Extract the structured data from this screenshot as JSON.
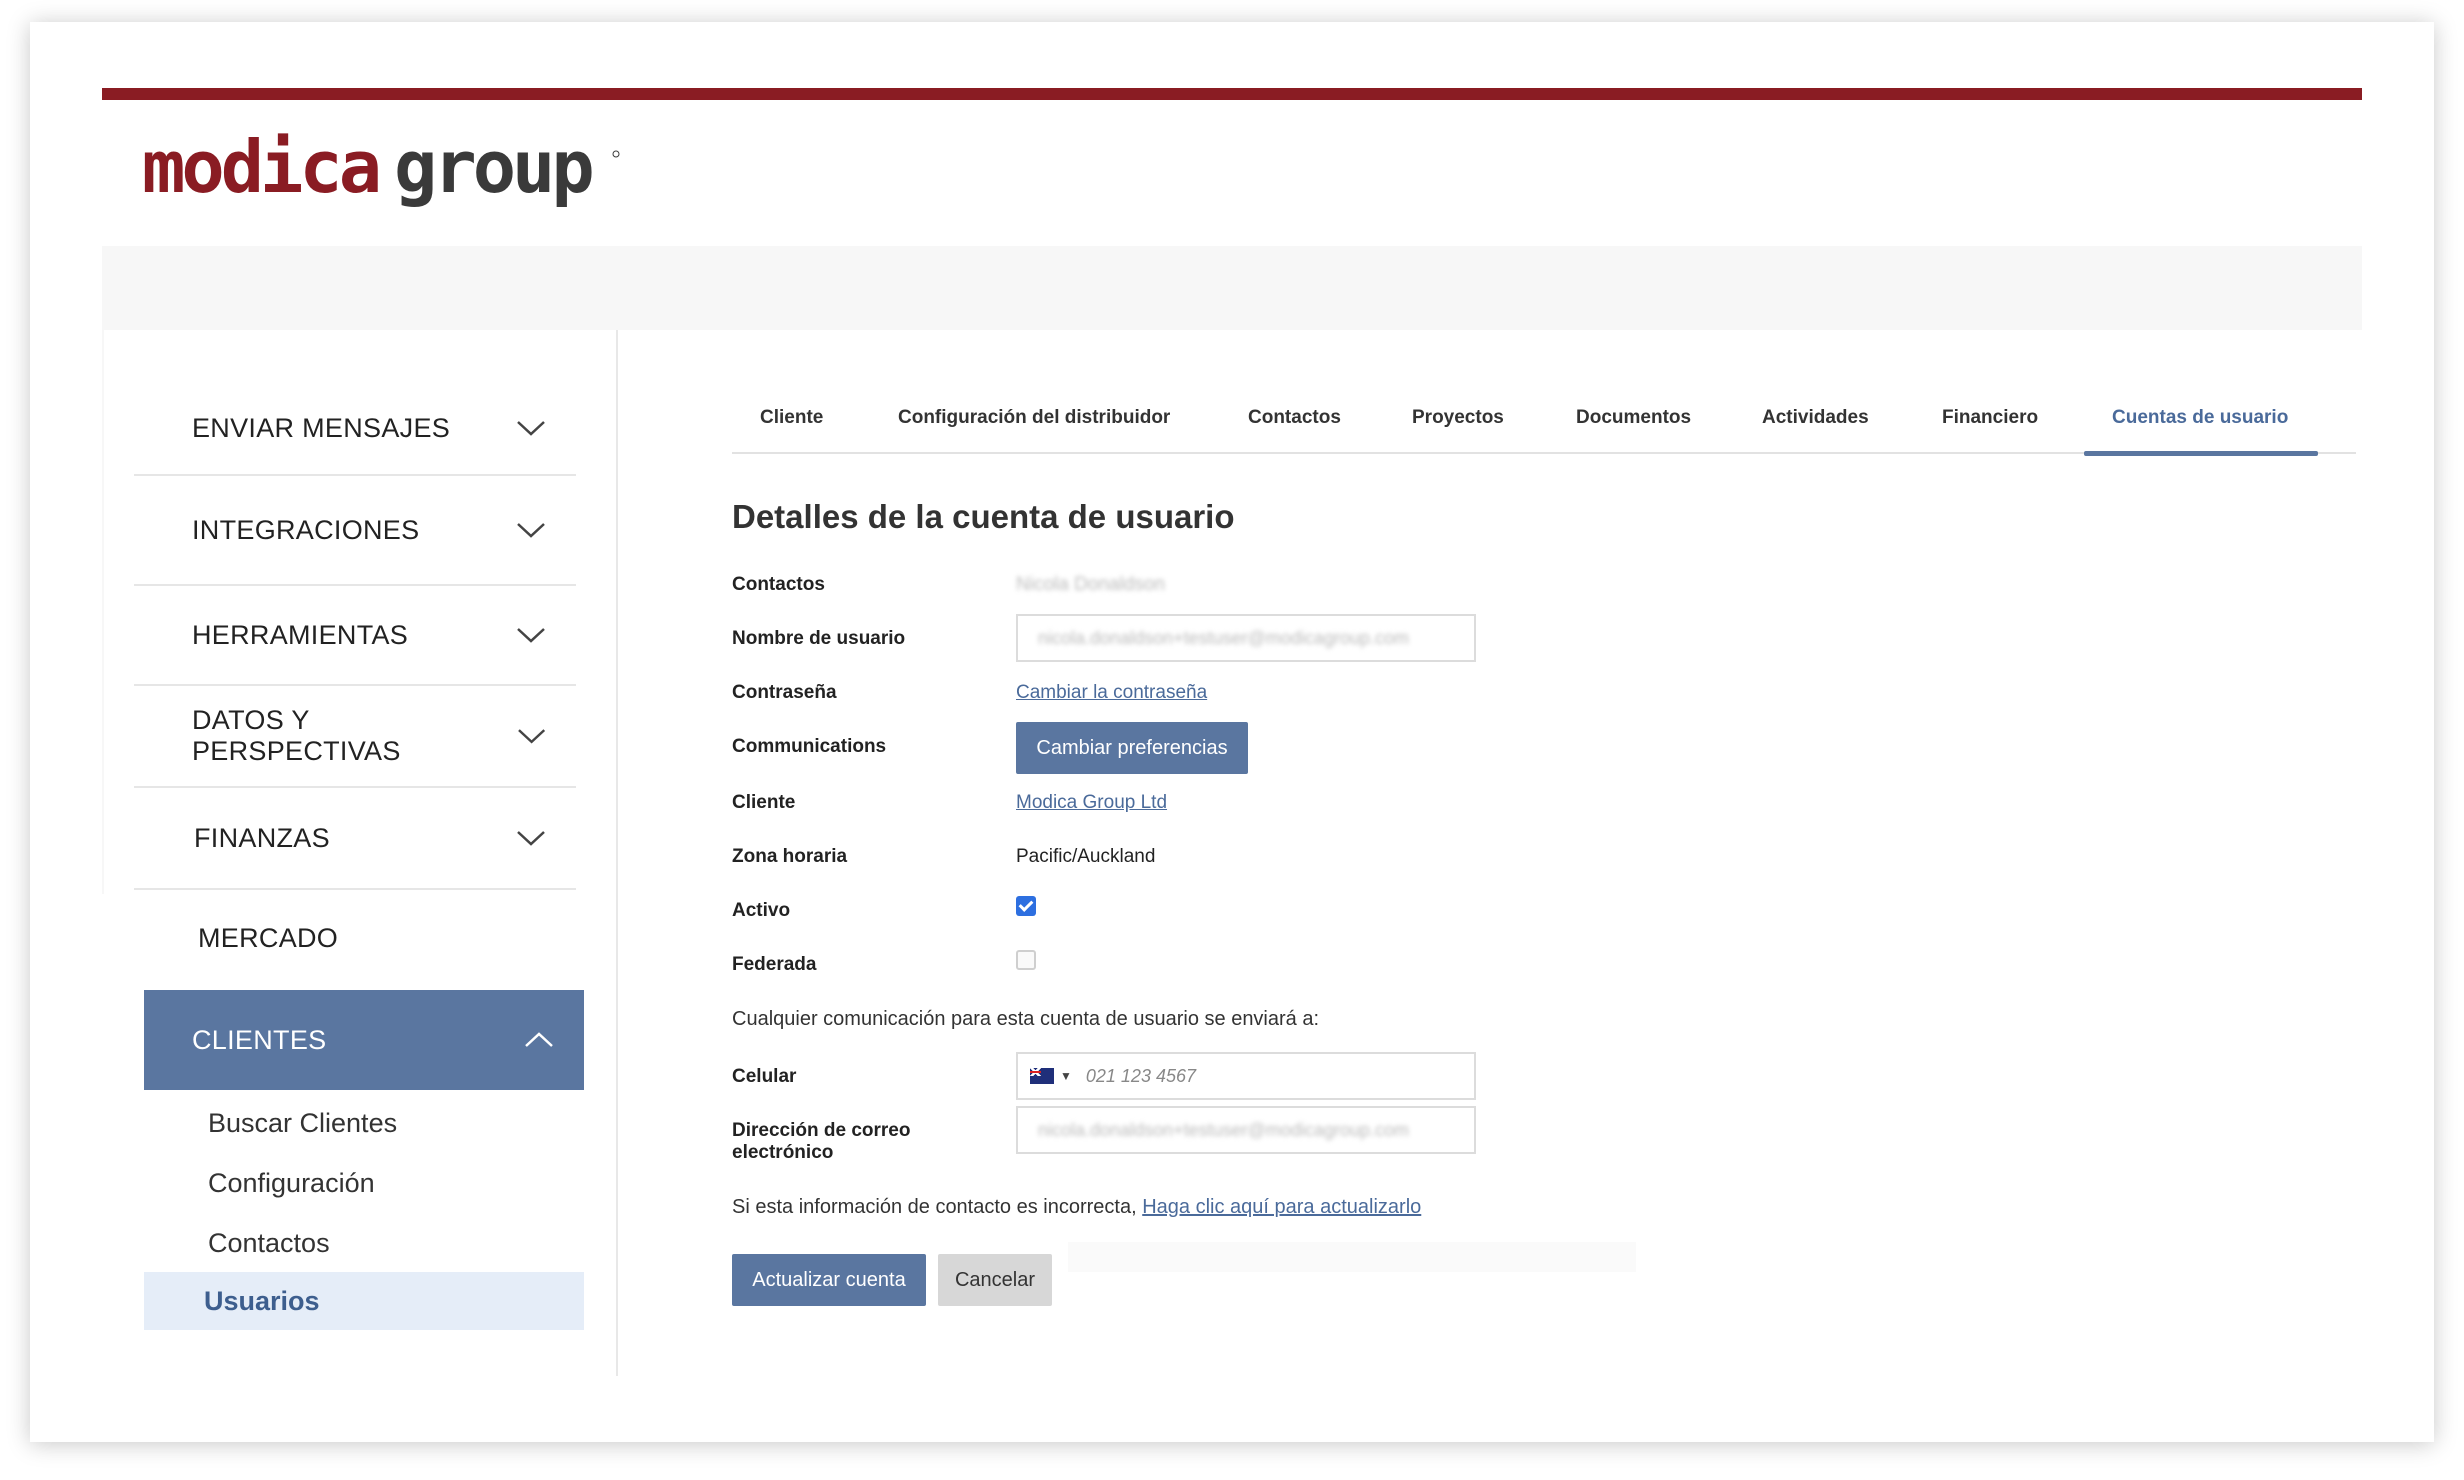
{
  "brand": {
    "logo_part1": "modica",
    "logo_part2": "group",
    "primary_color": "#8a1c23",
    "accent_color": "#5a76a0"
  },
  "sidebar": {
    "items": [
      {
        "label": "ENVIAR MENSAJES",
        "icon": "chevron-down-icon"
      },
      {
        "label": "INTEGRACIONES",
        "icon": "chevron-down-icon"
      },
      {
        "label": "HERRAMIENTAS",
        "icon": "chevron-down-icon"
      },
      {
        "label": "DATOS Y PERSPECTIVAS",
        "icon": "chevron-down-icon"
      },
      {
        "label": "FINANZAS",
        "icon": "chevron-down-icon"
      },
      {
        "label": "MERCADO"
      },
      {
        "label": "CLIENTES",
        "icon": "chevron-up-icon",
        "active": true
      }
    ],
    "subitems": [
      {
        "label": "Buscar Clientes"
      },
      {
        "label": "Configuración"
      },
      {
        "label": "Contactos"
      },
      {
        "label": "Usuarios",
        "active": true
      }
    ]
  },
  "tabs": [
    {
      "label": "Cliente"
    },
    {
      "label": "Configuración del distribuidor"
    },
    {
      "label": "Contactos"
    },
    {
      "label": "Proyectos"
    },
    {
      "label": "Documentos"
    },
    {
      "label": "Actividades"
    },
    {
      "label": "Financiero"
    },
    {
      "label": "Cuentas de usuario",
      "active": true
    }
  ],
  "form": {
    "title": "Detalles de la cuenta de usuario",
    "contactos_label": "Contactos",
    "contactos_value": "Nicola Donaldson",
    "username_label": "Nombre de usuario",
    "username_value": "nicola.donaldson+testuser@modicagroup.com",
    "password_label": "Contraseña",
    "password_link": "Cambiar la contraseña",
    "communications_label": "Communications",
    "communications_button": "Cambiar preferencias",
    "client_label": "Cliente",
    "client_link": "Modica Group Ltd",
    "timezone_label": "Zona horaria",
    "timezone_value": "Pacific/Auckland",
    "active_label": "Activo",
    "active_checked": true,
    "federated_label": "Federada",
    "federated_checked": false,
    "comm_info": "Cualquier comunicación para esta cuenta de usuario se enviará a:",
    "mobile_label": "Celular",
    "mobile_placeholder": "021 123 4567",
    "email_label_line1": "Dirección de correo",
    "email_label_line2": "electrónico",
    "email_value": "nicola.donaldson+testuser@modicagroup.com",
    "incorrect_text": "Si esta información de contacto es incorrecta,",
    "incorrect_link": "Haga clic aquí para actualizarlo",
    "update_button": "Actualizar cuenta",
    "cancel_button": "Cancelar"
  }
}
